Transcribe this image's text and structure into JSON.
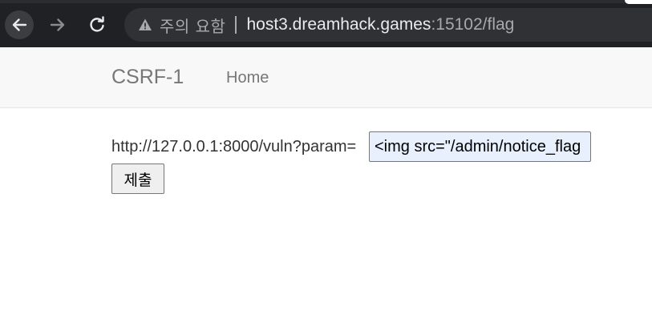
{
  "browser": {
    "security_label": "주의 요함",
    "url_host": "host3.dreamhack.games",
    "url_path": ":15102/flag",
    "icons": {
      "back": "arrow-left-icon",
      "forward": "arrow-right-icon",
      "reload": "reload-icon",
      "security": "warning-triangle-icon"
    }
  },
  "navbar": {
    "brand": "CSRF-1",
    "home_label": "Home"
  },
  "form": {
    "param_label": "http://127.0.0.1:8000/vuln?param=",
    "param_value": "<img src=\"/admin/notice_flag",
    "submit_label": "제출"
  },
  "colors": {
    "chrome_background": "#202124",
    "omnibox_background": "#303134",
    "input_autofill_background": "#e8f0fe",
    "navbar_background": "#f8f8f8",
    "navbar_text": "#777777"
  }
}
